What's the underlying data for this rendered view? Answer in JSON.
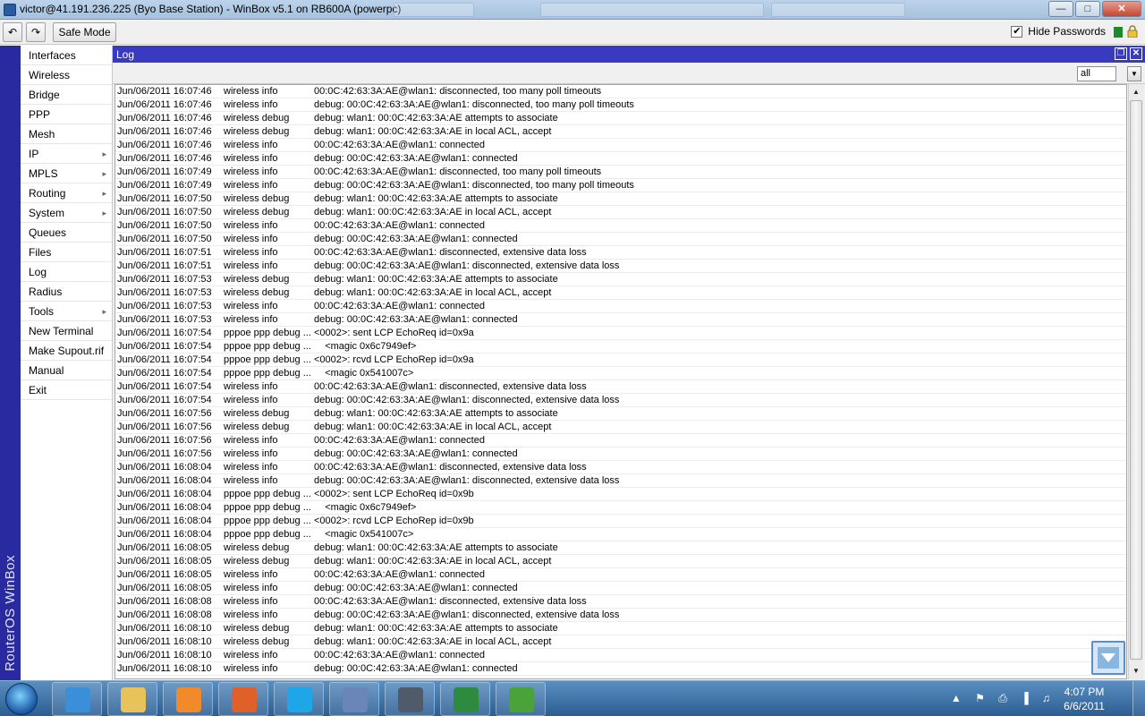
{
  "window": {
    "title": "victor@41.191.236.225 (Byo Base Station) - WinBox v5.1 on RB600A (powerpc)",
    "min_label": "—",
    "max_label": "□",
    "close_label": "✕"
  },
  "toolbar": {
    "undo_label": "↶",
    "redo_label": "↷",
    "safe_mode_label": "Safe Mode",
    "hide_passwords_label": "Hide Passwords",
    "hide_passwords_checked": "✔",
    "status_color": "#1e8a2e"
  },
  "brand": {
    "vertical_text": "RouterOS WinBox"
  },
  "sidebar": {
    "items": [
      {
        "label": "Interfaces",
        "arrow": ""
      },
      {
        "label": "Wireless",
        "arrow": ""
      },
      {
        "label": "Bridge",
        "arrow": ""
      },
      {
        "label": "PPP",
        "arrow": ""
      },
      {
        "label": "Mesh",
        "arrow": ""
      },
      {
        "label": "IP",
        "arrow": "▸"
      },
      {
        "label": "MPLS",
        "arrow": "▸"
      },
      {
        "label": "Routing",
        "arrow": "▸"
      },
      {
        "label": "System",
        "arrow": "▸"
      },
      {
        "label": "Queues",
        "arrow": ""
      },
      {
        "label": "Files",
        "arrow": ""
      },
      {
        "label": "Log",
        "arrow": ""
      },
      {
        "label": "Radius",
        "arrow": ""
      },
      {
        "label": "Tools",
        "arrow": "▸"
      },
      {
        "label": "New Terminal",
        "arrow": ""
      },
      {
        "label": "Make Supout.rif",
        "arrow": ""
      },
      {
        "label": "Manual",
        "arrow": ""
      },
      {
        "label": "Exit",
        "arrow": ""
      }
    ]
  },
  "log": {
    "title": "Log",
    "filter_value": "all",
    "rows": [
      {
        "time": "Jun/06/2011 16:07:46",
        "topics": "wireless info",
        "message": "00:0C:42:63:3A:AE@wlan1: disconnected, too many poll timeouts"
      },
      {
        "time": "Jun/06/2011 16:07:46",
        "topics": "wireless info",
        "message": "debug: 00:0C:42:63:3A:AE@wlan1: disconnected, too many poll timeouts"
      },
      {
        "time": "Jun/06/2011 16:07:46",
        "topics": "wireless debug",
        "message": "debug: wlan1: 00:0C:42:63:3A:AE attempts to associate"
      },
      {
        "time": "Jun/06/2011 16:07:46",
        "topics": "wireless debug",
        "message": "debug: wlan1: 00:0C:42:63:3A:AE in local ACL, accept"
      },
      {
        "time": "Jun/06/2011 16:07:46",
        "topics": "wireless info",
        "message": "00:0C:42:63:3A:AE@wlan1: connected"
      },
      {
        "time": "Jun/06/2011 16:07:46",
        "topics": "wireless info",
        "message": "debug: 00:0C:42:63:3A:AE@wlan1: connected"
      },
      {
        "time": "Jun/06/2011 16:07:49",
        "topics": "wireless info",
        "message": "00:0C:42:63:3A:AE@wlan1: disconnected, too many poll timeouts"
      },
      {
        "time": "Jun/06/2011 16:07:49",
        "topics": "wireless info",
        "message": "debug: 00:0C:42:63:3A:AE@wlan1: disconnected, too many poll timeouts"
      },
      {
        "time": "Jun/06/2011 16:07:50",
        "topics": "wireless debug",
        "message": "debug: wlan1: 00:0C:42:63:3A:AE attempts to associate"
      },
      {
        "time": "Jun/06/2011 16:07:50",
        "topics": "wireless debug",
        "message": "debug: wlan1: 00:0C:42:63:3A:AE in local ACL, accept"
      },
      {
        "time": "Jun/06/2011 16:07:50",
        "topics": "wireless info",
        "message": "00:0C:42:63:3A:AE@wlan1: connected"
      },
      {
        "time": "Jun/06/2011 16:07:50",
        "topics": "wireless info",
        "message": "debug: 00:0C:42:63:3A:AE@wlan1: connected"
      },
      {
        "time": "Jun/06/2011 16:07:51",
        "topics": "wireless info",
        "message": "00:0C:42:63:3A:AE@wlan1: disconnected, extensive data loss"
      },
      {
        "time": "Jun/06/2011 16:07:51",
        "topics": "wireless info",
        "message": "debug: 00:0C:42:63:3A:AE@wlan1: disconnected, extensive data loss"
      },
      {
        "time": "Jun/06/2011 16:07:53",
        "topics": "wireless debug",
        "message": "debug: wlan1: 00:0C:42:63:3A:AE attempts to associate"
      },
      {
        "time": "Jun/06/2011 16:07:53",
        "topics": "wireless debug",
        "message": "debug: wlan1: 00:0C:42:63:3A:AE in local ACL, accept"
      },
      {
        "time": "Jun/06/2011 16:07:53",
        "topics": "wireless info",
        "message": "00:0C:42:63:3A:AE@wlan1: connected"
      },
      {
        "time": "Jun/06/2011 16:07:53",
        "topics": "wireless info",
        "message": "debug: 00:0C:42:63:3A:AE@wlan1: connected"
      },
      {
        "time": "Jun/06/2011 16:07:54",
        "topics": "pppoe ppp debug ...",
        "message": "<0002>: sent LCP EchoReq id=0x9a"
      },
      {
        "time": "Jun/06/2011 16:07:54",
        "topics": "pppoe ppp debug ...",
        "message": "    <magic 0x6c7949ef>"
      },
      {
        "time": "Jun/06/2011 16:07:54",
        "topics": "pppoe ppp debug ...",
        "message": "<0002>: rcvd LCP EchoRep id=0x9a"
      },
      {
        "time": "Jun/06/2011 16:07:54",
        "topics": "pppoe ppp debug ...",
        "message": "    <magic 0x541007c>"
      },
      {
        "time": "Jun/06/2011 16:07:54",
        "topics": "wireless info",
        "message": "00:0C:42:63:3A:AE@wlan1: disconnected, extensive data loss"
      },
      {
        "time": "Jun/06/2011 16:07:54",
        "topics": "wireless info",
        "message": "debug: 00:0C:42:63:3A:AE@wlan1: disconnected, extensive data loss"
      },
      {
        "time": "Jun/06/2011 16:07:56",
        "topics": "wireless debug",
        "message": "debug: wlan1: 00:0C:42:63:3A:AE attempts to associate"
      },
      {
        "time": "Jun/06/2011 16:07:56",
        "topics": "wireless debug",
        "message": "debug: wlan1: 00:0C:42:63:3A:AE in local ACL, accept"
      },
      {
        "time": "Jun/06/2011 16:07:56",
        "topics": "wireless info",
        "message": "00:0C:42:63:3A:AE@wlan1: connected"
      },
      {
        "time": "Jun/06/2011 16:07:56",
        "topics": "wireless info",
        "message": "debug: 00:0C:42:63:3A:AE@wlan1: connected"
      },
      {
        "time": "Jun/06/2011 16:08:04",
        "topics": "wireless info",
        "message": "00:0C:42:63:3A:AE@wlan1: disconnected, extensive data loss"
      },
      {
        "time": "Jun/06/2011 16:08:04",
        "topics": "wireless info",
        "message": "debug: 00:0C:42:63:3A:AE@wlan1: disconnected, extensive data loss"
      },
      {
        "time": "Jun/06/2011 16:08:04",
        "topics": "pppoe ppp debug ...",
        "message": "<0002>: sent LCP EchoReq id=0x9b"
      },
      {
        "time": "Jun/06/2011 16:08:04",
        "topics": "pppoe ppp debug ...",
        "message": "    <magic 0x6c7949ef>"
      },
      {
        "time": "Jun/06/2011 16:08:04",
        "topics": "pppoe ppp debug ...",
        "message": "<0002>: rcvd LCP EchoRep id=0x9b"
      },
      {
        "time": "Jun/06/2011 16:08:04",
        "topics": "pppoe ppp debug ...",
        "message": "    <magic 0x541007c>"
      },
      {
        "time": "Jun/06/2011 16:08:05",
        "topics": "wireless debug",
        "message": "debug: wlan1: 00:0C:42:63:3A:AE attempts to associate"
      },
      {
        "time": "Jun/06/2011 16:08:05",
        "topics": "wireless debug",
        "message": "debug: wlan1: 00:0C:42:63:3A:AE in local ACL, accept"
      },
      {
        "time": "Jun/06/2011 16:08:05",
        "topics": "wireless info",
        "message": "00:0C:42:63:3A:AE@wlan1: connected"
      },
      {
        "time": "Jun/06/2011 16:08:05",
        "topics": "wireless info",
        "message": "debug: 00:0C:42:63:3A:AE@wlan1: connected"
      },
      {
        "time": "Jun/06/2011 16:08:08",
        "topics": "wireless info",
        "message": "00:0C:42:63:3A:AE@wlan1: disconnected, extensive data loss"
      },
      {
        "time": "Jun/06/2011 16:08:08",
        "topics": "wireless info",
        "message": "debug: 00:0C:42:63:3A:AE@wlan1: disconnected, extensive data loss"
      },
      {
        "time": "Jun/06/2011 16:08:10",
        "topics": "wireless debug",
        "message": "debug: wlan1: 00:0C:42:63:3A:AE attempts to associate"
      },
      {
        "time": "Jun/06/2011 16:08:10",
        "topics": "wireless debug",
        "message": "debug: wlan1: 00:0C:42:63:3A:AE in local ACL, accept"
      },
      {
        "time": "Jun/06/2011 16:08:10",
        "topics": "wireless info",
        "message": "00:0C:42:63:3A:AE@wlan1: connected"
      },
      {
        "time": "Jun/06/2011 16:08:10",
        "topics": "wireless info",
        "message": "debug: 00:0C:42:63:3A:AE@wlan1: connected"
      }
    ]
  },
  "taskbar": {
    "apps": [
      {
        "name": "ie",
        "icon": "internet-explorer-icon",
        "color": "#3b8fd8"
      },
      {
        "name": "explorer",
        "icon": "folder-icon",
        "color": "#e8c25a"
      },
      {
        "name": "media",
        "icon": "media-player-icon",
        "color": "#f08a2a"
      },
      {
        "name": "firefox",
        "icon": "firefox-icon",
        "color": "#e0602a"
      },
      {
        "name": "skype",
        "icon": "skype-icon",
        "color": "#1fa6e8"
      },
      {
        "name": "virtualbox",
        "icon": "virtualbox-icon",
        "color": "#6a86b8"
      },
      {
        "name": "winbox",
        "icon": "winbox-icon",
        "color": "#505a6a"
      },
      {
        "name": "excel",
        "icon": "excel-icon",
        "color": "#2e8a3e"
      },
      {
        "name": "utorrent",
        "icon": "utorrent-icon",
        "color": "#4aa33a"
      }
    ],
    "tray_icons": "▲ ⚑ ⎙ ▐ ♫",
    "clock_time": "4:07 PM",
    "clock_date": "6/6/2011"
  }
}
